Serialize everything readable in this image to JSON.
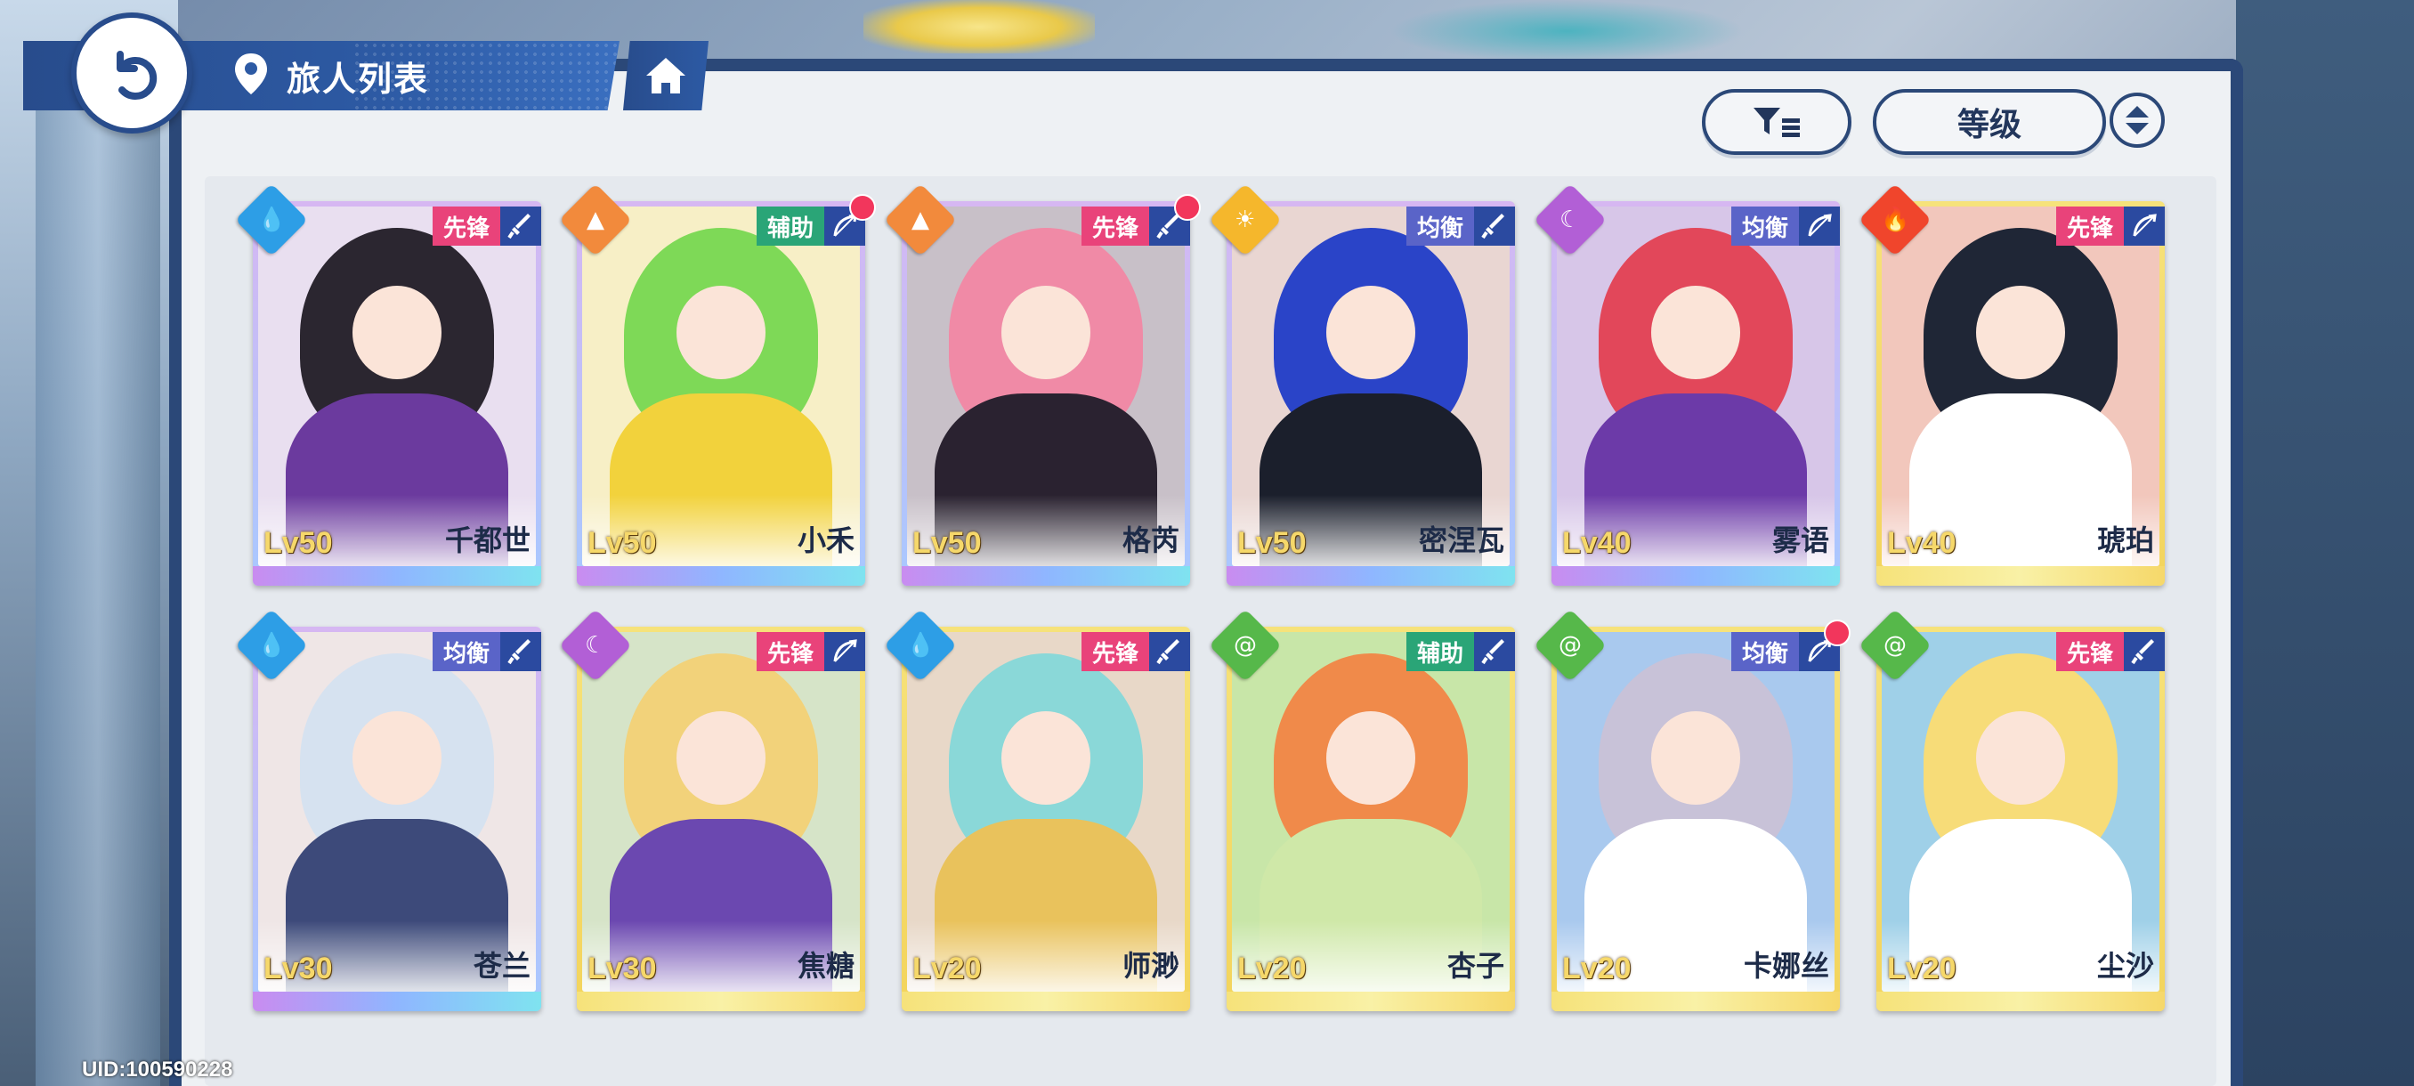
{
  "header": {
    "title": "旅人列表"
  },
  "toolbar": {
    "sort_label": "等级"
  },
  "uid": "UID:100590228",
  "colors": {
    "water": "#2d9ee6",
    "earth": "#f28a3c",
    "light": "#f5b72c",
    "dark": "#b25fd6",
    "fire": "#f0452c",
    "wind": "#56b84a"
  },
  "cards": [
    {
      "name": "千都世",
      "level": "Lv50",
      "role": "先锋",
      "element": "water",
      "weapon": "sword",
      "rarity": "ur",
      "dot": false,
      "hair": "#2b2630",
      "outfit": "#6b3a9e",
      "bg": "#e9dff0"
    },
    {
      "name": "小禾",
      "level": "Lv50",
      "role": "辅助",
      "element": "earth",
      "weapon": "bow",
      "rarity": "ur",
      "dot": true,
      "hair": "#7ed957",
      "outfit": "#f2d23c",
      "bg": "#f7efc6"
    },
    {
      "name": "格芮",
      "level": "Lv50",
      "role": "先锋",
      "element": "earth",
      "weapon": "sword",
      "rarity": "ur",
      "dot": true,
      "hair": "#f08aa6",
      "outfit": "#2a2230",
      "bg": "#c8c0c8"
    },
    {
      "name": "密涅瓦",
      "level": "Lv50",
      "role": "均衡",
      "element": "light",
      "weapon": "sword",
      "rarity": "ur",
      "dot": false,
      "hair": "#2a44c8",
      "outfit": "#1b1f2c",
      "bg": "#e9d6d2"
    },
    {
      "name": "雾语",
      "level": "Lv40",
      "role": "均衡",
      "element": "dark",
      "weapon": "bow",
      "rarity": "ur",
      "dot": false,
      "hair": "#e2475a",
      "outfit": "#6c3aa8",
      "bg": "#d7c6e8"
    },
    {
      "name": "琥珀",
      "level": "Lv40",
      "role": "先锋",
      "element": "fire",
      "weapon": "bow",
      "rarity": "ssr",
      "dot": false,
      "hair": "#1f2636",
      "outfit": "#ffffff",
      "bg": "#f2c7bc"
    },
    {
      "name": "苍兰",
      "level": "Lv30",
      "role": "均衡",
      "element": "water",
      "weapon": "sword",
      "rarity": "ur",
      "dot": false,
      "hair": "#d6e2f0",
      "outfit": "#3d4a7a",
      "bg": "#efe6e6"
    },
    {
      "name": "焦糖",
      "level": "Lv30",
      "role": "先锋",
      "element": "dark",
      "weapon": "bow",
      "rarity": "ssr",
      "dot": false,
      "hair": "#f2d27a",
      "outfit": "#6b48b0",
      "bg": "#d6e4c8"
    },
    {
      "name": "师渺",
      "level": "Lv20",
      "role": "先锋",
      "element": "water",
      "weapon": "sword",
      "rarity": "ssr",
      "dot": false,
      "hair": "#8ad8d8",
      "outfit": "#e9c25c",
      "bg": "#e8d8c8"
    },
    {
      "name": "杏子",
      "level": "Lv20",
      "role": "辅助",
      "element": "wind",
      "weapon": "sword",
      "rarity": "ssr",
      "dot": false,
      "hair": "#f08a4a",
      "outfit": "#cfe8a8",
      "bg": "#c8e6a8"
    },
    {
      "name": "卡娜丝",
      "level": "Lv20",
      "role": "均衡",
      "element": "wind",
      "weapon": "bow",
      "rarity": "ssr",
      "dot": true,
      "hair": "#c8c2d8",
      "outfit": "#ffffff",
      "bg": "#a9c9ee"
    },
    {
      "name": "尘沙",
      "level": "Lv20",
      "role": "先锋",
      "element": "wind",
      "weapon": "sword",
      "rarity": "ssr",
      "dot": false,
      "hair": "#f7dc78",
      "outfit": "#ffffff",
      "bg": "#9fd0e8"
    }
  ]
}
